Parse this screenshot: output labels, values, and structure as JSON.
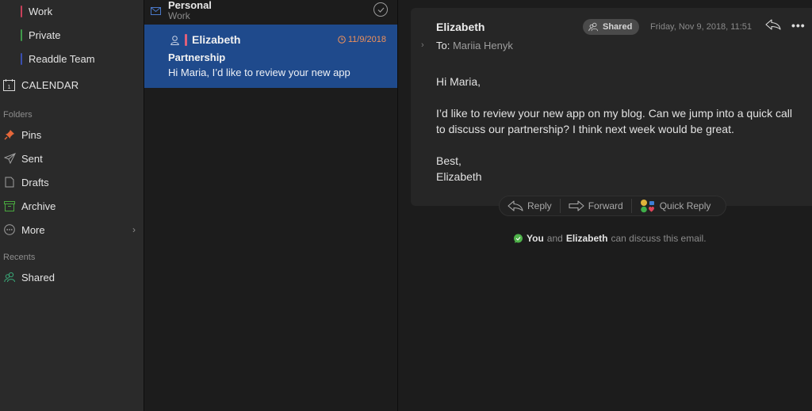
{
  "sidebar": {
    "tags": [
      {
        "label": "Work",
        "color": "#c8405a"
      },
      {
        "label": "Private",
        "color": "#3f9a4a"
      },
      {
        "label": "Readdle Team",
        "color": "#3a4fb0"
      }
    ],
    "calendar": {
      "label": "CALENDAR",
      "icon": "calendar-icon",
      "day": "1"
    },
    "folders_header": "Folders",
    "folders": [
      {
        "label": "Pins",
        "icon": "pin-icon",
        "color": "#e5673a"
      },
      {
        "label": "Sent",
        "icon": "paper-plane-icon",
        "color": "#a0a0a0"
      },
      {
        "label": "Drafts",
        "icon": "document-icon",
        "color": "#a0a0a0"
      },
      {
        "label": "Archive",
        "icon": "archive-box-icon",
        "color": "#49a83f"
      },
      {
        "label": "More",
        "icon": "ellipsis-circle-icon",
        "color": "#a0a0a0"
      }
    ],
    "recents_header": "Recents",
    "recents": [
      {
        "label": "Shared",
        "icon": "people-icon",
        "color": "#3aa878"
      }
    ]
  },
  "message_list": {
    "group": {
      "title": "Personal",
      "subtitle": "Work"
    },
    "messages": [
      {
        "from": "Elizabeth",
        "date": "11/9/2018",
        "subject": "Partnership",
        "preview": "Hi Maria, I’d like to review your new app",
        "tag_color": "#e0607a",
        "selected": true
      }
    ]
  },
  "reader": {
    "from": "Elizabeth",
    "to_label": "To:",
    "to": "Mariia Henyk",
    "shared_label": "Shared",
    "date": "Friday, Nov 9, 2018, 11:51",
    "body": {
      "greeting": "Hi Maria,",
      "paragraph": "I’d like to review your new app on my blog. Can we jump into a quick call to discuss our partnership? I think next week would be great.",
      "signoff": "Best,",
      "signature": "Elizabeth"
    },
    "actions": {
      "reply": "Reply",
      "forward": "Forward",
      "quick_reply": "Quick Reply"
    },
    "discussion": {
      "you": "You",
      "and": "and",
      "other": "Elizabeth",
      "rest": "can discuss this email."
    }
  },
  "colors": {
    "selection": "#1f4a8c",
    "date_accent": "#f0915a"
  }
}
